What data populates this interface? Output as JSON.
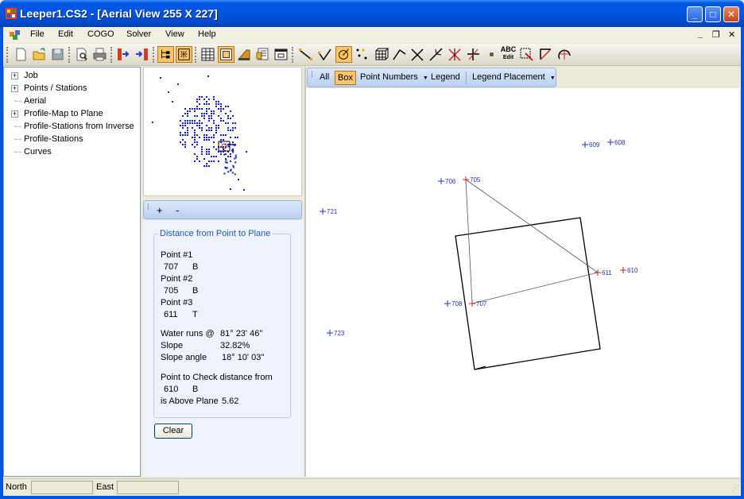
{
  "window": {
    "title": "Leeper1.CS2 - [Aerial View   255  X  227]",
    "minimize": "_",
    "maximize": "□",
    "close": "✕"
  },
  "menu": {
    "items": [
      "File",
      "Edit",
      "COGO",
      "Solver",
      "View",
      "Help"
    ],
    "mdi_minimize": "_",
    "mdi_restore": "❐",
    "mdi_close": "✕"
  },
  "toolbar": {
    "icons": [
      "new-icon",
      "open-icon",
      "save-icon",
      "print-preview-icon",
      "print-icon",
      "export-icon",
      "import-icon",
      "tree-view-icon",
      "fit-view-icon",
      "grid-icon",
      "window-icon",
      "bulldozer-icon",
      "properties-icon",
      "dialog-icon",
      "line-icon",
      "check-icon",
      "point-target-icon",
      "dots-icon",
      "cube-grid-icon",
      "angle-icon",
      "intersect-icon",
      "tangent-icon",
      "cross-icon",
      "perpendicular-icon",
      "point-icon",
      "edit-label-icon",
      "zoom-box-icon",
      "angle-measure-icon",
      "arc-icon"
    ],
    "abc_label": "ABC",
    "edit_label": "Edit"
  },
  "tree": {
    "items": [
      {
        "label": "Job",
        "expandable": true
      },
      {
        "label": "Points / Stations",
        "expandable": true
      },
      {
        "label": "Aerial",
        "expandable": false
      },
      {
        "label": "Profile-Map to Plane",
        "expandable": true
      },
      {
        "label": "Profile-Stations from Inverse",
        "expandable": false
      },
      {
        "label": "Profile-Stations",
        "expandable": false
      },
      {
        "label": "Curves",
        "expandable": false
      }
    ]
  },
  "zoom": {
    "plus": "+",
    "minus": "-"
  },
  "distance_panel": {
    "title": "Distance from Point to Plane",
    "point1_label": "Point #1",
    "point1_value": "707",
    "point1_code": "B",
    "point2_label": "Point #2",
    "point2_value": "705",
    "point2_code": "B",
    "point3_label": "Point #3",
    "point3_value": "611",
    "point3_code": "T",
    "water_label": "Water runs @",
    "water_value": "81° 23' 46''",
    "slope_label": "Slope",
    "slope_value": "32.82%",
    "slope_angle_label": "Slope angle",
    "slope_angle_value": "18° 10' 03''",
    "check_label": "Point to Check distance from",
    "check_point": "610",
    "check_code": "B",
    "result_label": "is Above Plane",
    "result_value": "5.62",
    "clear_button": "Clear"
  },
  "plot_toolbar": {
    "all": "All",
    "box": "Box",
    "point_numbers": "Point Numbers",
    "legend": "Legend",
    "legend_placement": "Legend Placement"
  },
  "plot_points": [
    {
      "id": "609",
      "color": "#2030c0"
    },
    {
      "id": "608",
      "color": "#2030c0"
    },
    {
      "id": "706",
      "color": "#2030c0"
    },
    {
      "id": "705",
      "color": "#d02020"
    },
    {
      "id": "721",
      "color": "#2030c0"
    },
    {
      "id": "611",
      "color": "#d02020"
    },
    {
      "id": "610",
      "color": "#d02020"
    },
    {
      "id": "708",
      "color": "#2030c0"
    },
    {
      "id": "707",
      "color": "#d02020"
    },
    {
      "id": "723",
      "color": "#2030c0"
    }
  ],
  "status": {
    "north_label": "North",
    "north_value": "",
    "east_label": "East",
    "east_value": ""
  }
}
